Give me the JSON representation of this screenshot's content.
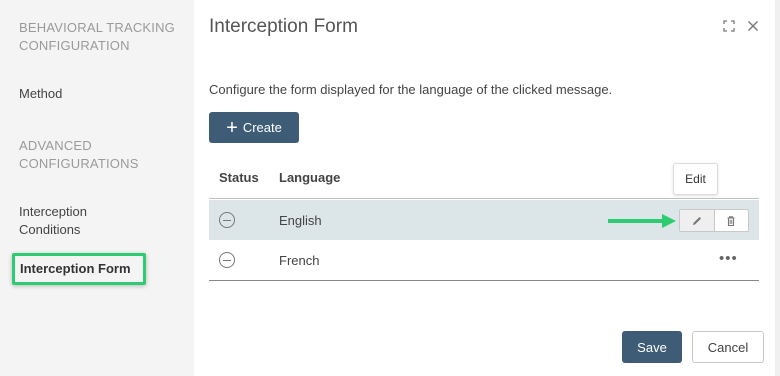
{
  "sidebar": {
    "section_behavioral": "BEHAVIORAL TRACKING CONFIGURATION",
    "method": "Method",
    "section_advanced": "ADVANCED CONFIGURATIONS",
    "interception_conditions": "Interception Conditions",
    "interception_form": "Interception Form"
  },
  "header": {
    "title": "Interception Form",
    "expand_icon": "expand-icon",
    "close_icon": "close-icon"
  },
  "main": {
    "description": "Configure the form displayed for the language of the clicked message.",
    "create_label": "Create",
    "create_icon": "plus-icon"
  },
  "table": {
    "columns": [
      "Status",
      "Language"
    ],
    "rows": [
      {
        "language": "English",
        "highlighted": true
      },
      {
        "language": "French",
        "highlighted": false
      }
    ],
    "more_label": "•••",
    "edit_tooltip": "Edit"
  },
  "footer": {
    "save_label": "Save",
    "cancel_label": "Cancel"
  },
  "colors": {
    "primary": "#3e5c76",
    "highlight_row": "#dce5e7",
    "annotation_green": "#2ecc71"
  }
}
